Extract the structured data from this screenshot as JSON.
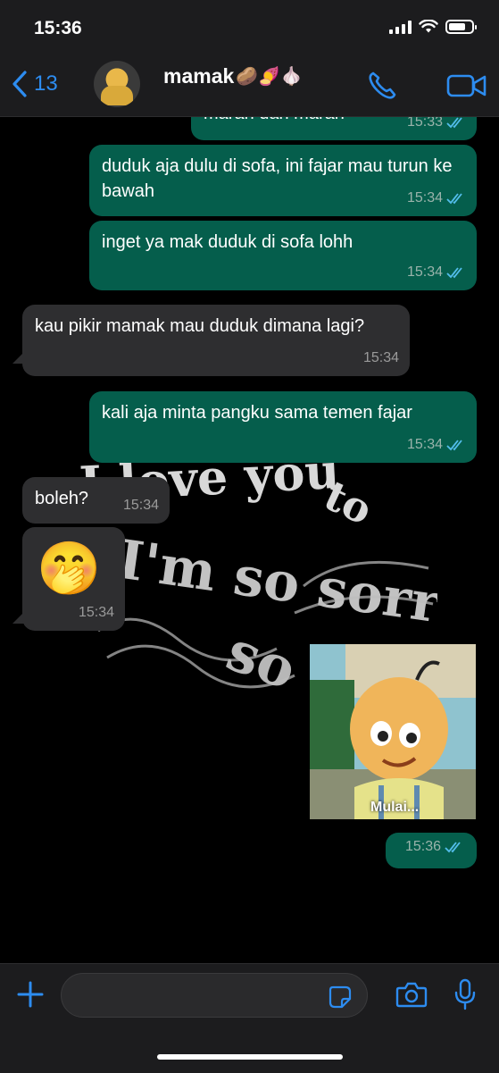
{
  "status_bar": {
    "time": "15:36",
    "battery_level": 0.75
  },
  "header": {
    "back_count": "13",
    "contact_name": "mamak",
    "contact_emoji": "🥔🍠🧄"
  },
  "messages": [
    {
      "direction": "out",
      "text": "marah dan marah",
      "time": "15:33"
    },
    {
      "direction": "out",
      "text": "duduk aja dulu di sofa, ini fajar mau turun ke bawah",
      "time": "15:34"
    },
    {
      "direction": "out",
      "text": "inget ya mak duduk di sofa lohh",
      "time": "15:34"
    },
    {
      "direction": "in",
      "text": "kau pikir mamak mau duduk dimana lagi?",
      "time": "15:34"
    },
    {
      "direction": "out",
      "text": "kali aja minta pangku sama temen fajar",
      "time": "15:34"
    },
    {
      "direction": "in",
      "text": "boleh?",
      "time": "15:34"
    },
    {
      "direction": "in",
      "text": "🤭",
      "time": "15:34"
    },
    {
      "direction": "out",
      "type": "image",
      "image_caption": "Mulai...",
      "time": "15:36"
    }
  ],
  "wallpaper": {
    "texts": [
      "I love you",
      "to",
      "I'm so sorry",
      "so"
    ]
  },
  "colors": {
    "outgoing_bubble": "#055e4c",
    "incoming_bubble": "#2e2e30",
    "accent": "#2d8cf0",
    "read_ticks": "#53bdeb"
  }
}
